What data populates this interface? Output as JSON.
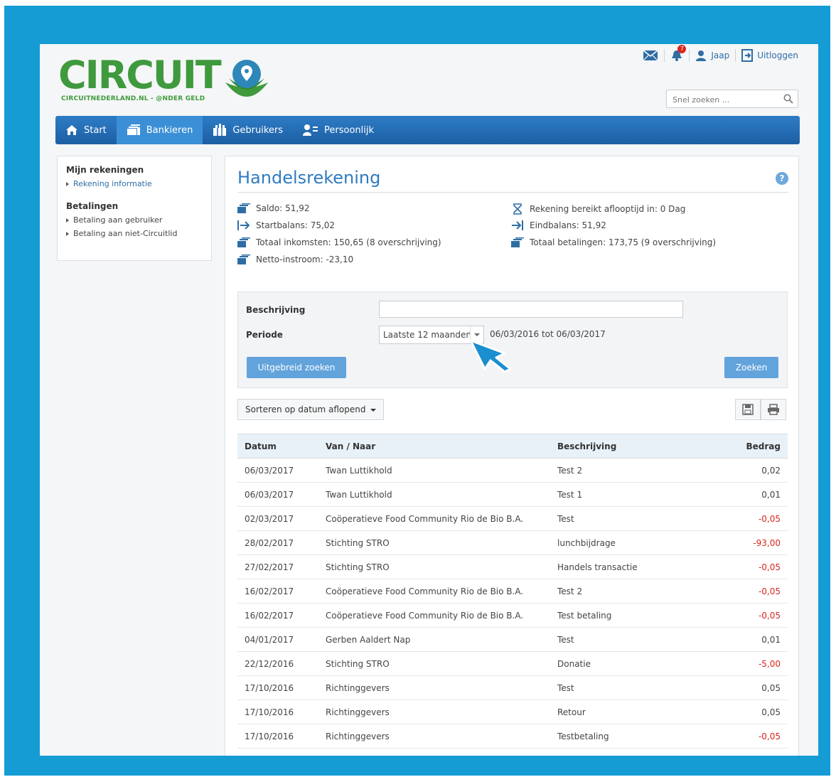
{
  "brand": {
    "name": "CIRCUIT",
    "tagline": "CIRCUITNEDERLAND.NL - @NDER GELD",
    "color": "#3f9a3d",
    "frame_color": "#159cd5"
  },
  "topbar": {
    "notification_count": "7",
    "user_name": "Jaap",
    "logout_label": "Uitloggen"
  },
  "search": {
    "placeholder": "Snel zoeken ..."
  },
  "nav": {
    "items": [
      {
        "label": "Start",
        "icon": "home-icon"
      },
      {
        "label": "Bankieren",
        "icon": "bank-icon"
      },
      {
        "label": "Gebruikers",
        "icon": "users-icon"
      },
      {
        "label": "Persoonlijk",
        "icon": "profile-icon"
      }
    ],
    "active": "Bankieren"
  },
  "sidebar": {
    "sections": [
      {
        "title": "Mijn rekeningen",
        "links": [
          "Rekening informatie"
        ]
      },
      {
        "title": "Betalingen",
        "links": [
          "Betaling aan gebruiker",
          "Betaling aan niet-Circuitlid"
        ]
      }
    ]
  },
  "account": {
    "title": "Handelsrekening",
    "stats": {
      "saldo": "Saldo: 51,92",
      "startbalans": "Startbalans: 75,02",
      "inkomsten": "Totaal inkomsten: 150,65 (8 overschrijving)",
      "netto": "Netto-instroom: -23,10",
      "aflooptijd": "Rekening bereikt aflooptijd in: 0 Dag",
      "eindbalans": "Eindbalans: 51,92",
      "betalingen": "Totaal betalingen: 173,75 (9 overschrijving)"
    }
  },
  "filter": {
    "description_label": "Beschrijving",
    "description_value": "",
    "period_label": "Periode",
    "period_value": "Laatste 12 maanden",
    "period_range": "06/03/2016 tot 06/03/2017",
    "advanced_button": "Uitgebreid zoeken",
    "search_button": "Zoeken"
  },
  "sort": {
    "label": "Sorteren op datum aflopend"
  },
  "table": {
    "headers": {
      "date": "Datum",
      "party": "Van / Naar",
      "desc": "Beschrijving",
      "amount": "Bedrag"
    },
    "rows": [
      {
        "date": "06/03/2017",
        "party": "Twan Luttikhold",
        "desc": "Test 2",
        "amount": "0,02",
        "negative": false
      },
      {
        "date": "06/03/2017",
        "party": "Twan Luttikhold",
        "desc": "Test 1",
        "amount": "0,01",
        "negative": false
      },
      {
        "date": "02/03/2017",
        "party": "Coöperatieve Food Community Rio de Bio B.A.",
        "desc": "Test",
        "amount": "-0,05",
        "negative": true
      },
      {
        "date": "28/02/2017",
        "party": "Stichting STRO",
        "desc": "lunchbijdrage",
        "amount": "-93,00",
        "negative": true
      },
      {
        "date": "27/02/2017",
        "party": "Stichting STRO",
        "desc": "Handels transactie",
        "amount": "-0,05",
        "negative": true
      },
      {
        "date": "16/02/2017",
        "party": "Coöperatieve Food Community Rio de Bio B.A.",
        "desc": "Test 2",
        "amount": "-0,05",
        "negative": true
      },
      {
        "date": "16/02/2017",
        "party": "Coöperatieve Food Community Rio de Bio B.A.",
        "desc": "Test betaling",
        "amount": "-0,05",
        "negative": true
      },
      {
        "date": "04/01/2017",
        "party": "Gerben Aaldert Nap",
        "desc": "Test",
        "amount": "0,01",
        "negative": false
      },
      {
        "date": "22/12/2016",
        "party": "Stichting STRO",
        "desc": "Donatie",
        "amount": "-5,00",
        "negative": true
      },
      {
        "date": "17/10/2016",
        "party": "Richtinggevers",
        "desc": "Test",
        "amount": "0,05",
        "negative": false
      },
      {
        "date": "17/10/2016",
        "party": "Richtinggevers",
        "desc": "Retour",
        "amount": "0,05",
        "negative": false
      },
      {
        "date": "17/10/2016",
        "party": "Richtinggevers",
        "desc": "Testbetaling",
        "amount": "-0,05",
        "negative": true
      }
    ]
  }
}
